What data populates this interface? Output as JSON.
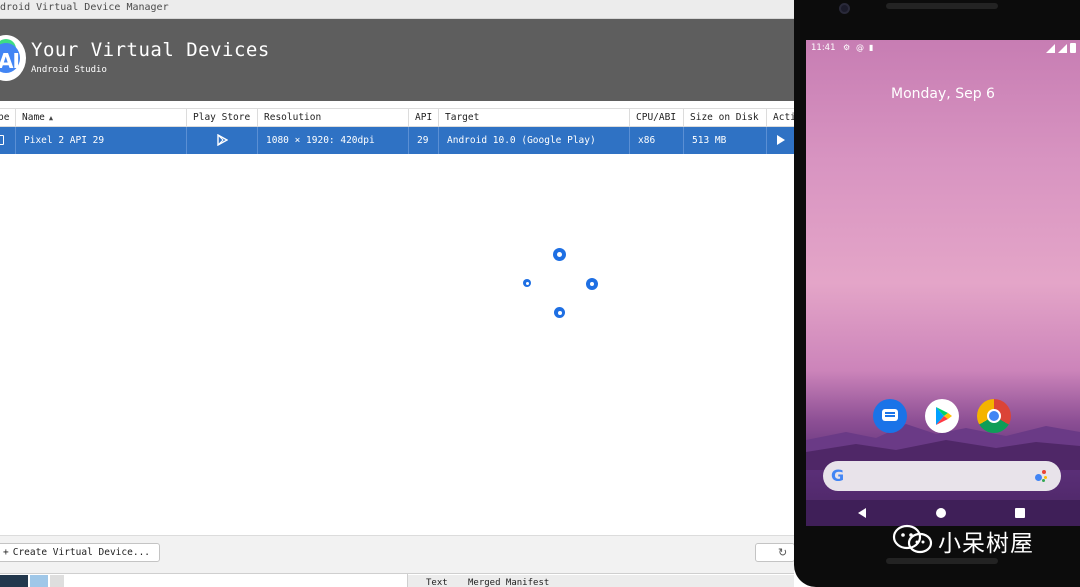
{
  "window": {
    "title": "ndroid Virtual Device Manager"
  },
  "banner": {
    "title": "Your Virtual Devices",
    "subtitle": "Android Studio",
    "logo_icon": "android-studio-logo",
    "logo_text": "AI"
  },
  "table": {
    "headers": [
      {
        "label": "pe"
      },
      {
        "label": "Name",
        "sort": "▲"
      },
      {
        "label": "Play Store"
      },
      {
        "label": "Resolution"
      },
      {
        "label": "API"
      },
      {
        "label": "Target"
      },
      {
        "label": "CPU/ABI"
      },
      {
        "label": "Size on Disk"
      },
      {
        "label": "Acti"
      }
    ],
    "rows": [
      {
        "type_icon": "phone-icon",
        "name": "Pixel 2 API 29",
        "play_store_icon": "play-store-icon",
        "resolution": "1080 × 1920: 420dpi",
        "api": "29",
        "target": "Android 10.0 (Google Play)",
        "cpu_abi": "x86",
        "size_on_disk": "513 MB",
        "action_icon": "launch-play-icon",
        "selected": true
      }
    ]
  },
  "loading_indicator": {
    "icon": "loading-spinner-icon"
  },
  "footer": {
    "create_button": "Create Virtual Device...",
    "create_button_icon": "+",
    "refresh_icon": "↻"
  },
  "ide_strip": {
    "tabs": [
      "Text",
      "Merged Manifest"
    ]
  },
  "emulator": {
    "status_time": "11:41",
    "status_icons": [
      "⚙",
      "@",
      "▮"
    ],
    "date": "Monday, Sep 6",
    "apps": [
      "messages-icon",
      "play-store-icon",
      "chrome-icon"
    ],
    "search_icon": "G",
    "nav": [
      "back-icon",
      "home-icon",
      "recents-icon"
    ]
  },
  "watermark": {
    "text": "小呆树屋",
    "icon": "wechat-logo-icon"
  },
  "colors": {
    "selection": "#2f72c4",
    "banner": "#5e5e5e",
    "spinner": "#1e6fe3",
    "nav_bar": "#3f1f58"
  }
}
